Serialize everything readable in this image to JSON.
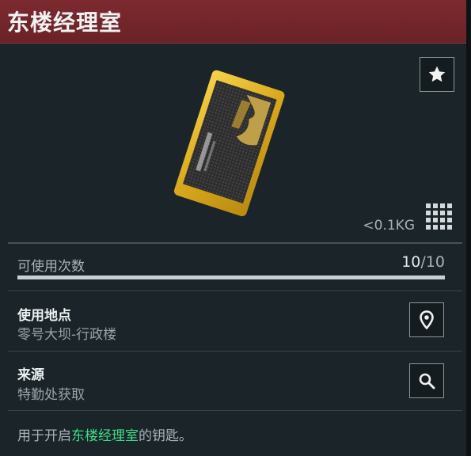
{
  "header": {
    "title": "东楼经理室"
  },
  "item": {
    "weight": "<0.1KG"
  },
  "uses": {
    "label": "可使用次数",
    "current": "10",
    "separator": "/",
    "max": "10",
    "fraction": 1.0
  },
  "location": {
    "title": "使用地点",
    "value": "零号大坝-行政楼"
  },
  "source": {
    "title": "来源",
    "value": "特勤处获取"
  },
  "description": {
    "prefix": "用于开启",
    "highlight": "东楼经理室",
    "suffix": "的钥匙。"
  },
  "colors": {
    "header": "#7c2a30",
    "highlight": "#3ddc88",
    "background": "#1b2428"
  },
  "icons": {
    "favorite": "star-icon",
    "size": "grid-icon",
    "location": "map-pin-icon",
    "source": "search-icon"
  }
}
